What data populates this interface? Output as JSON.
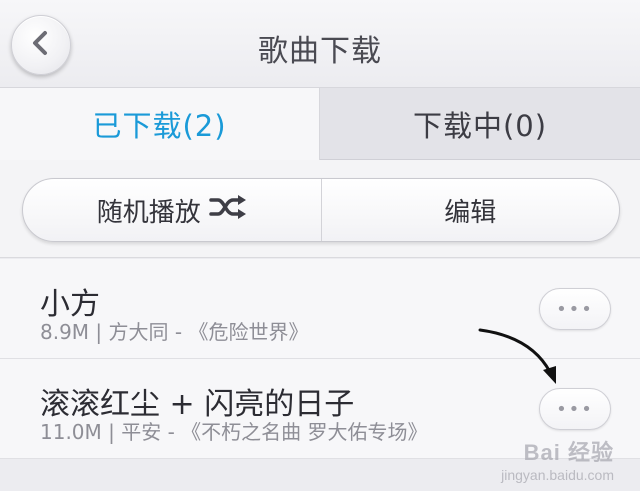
{
  "header": {
    "title": "歌曲下载",
    "back_icon": "chevron-left-icon"
  },
  "tabs": [
    {
      "label": "已下载(2)",
      "active": true
    },
    {
      "label": "下载中(0)",
      "active": false
    }
  ],
  "actions": {
    "shuffle_label": "随机播放",
    "shuffle_icon": "shuffle-icon",
    "edit_label": "编辑"
  },
  "songs": [
    {
      "title": "小方",
      "meta": "8.9M | 方大同 - 《危险世界》",
      "more_label": "•••"
    },
    {
      "title": "滚滚红尘 + 闪亮的日子",
      "meta": "11.0M | 平安 - 《不朽之名曲 罗大佑专场》",
      "more_label": "•••"
    }
  ],
  "watermark": {
    "brand": "Bai 经验",
    "url": "jingyan.baidu.com"
  },
  "colors": {
    "accent": "#1a9ad8",
    "background": "#ececf0",
    "text_primary": "#2c2c33",
    "text_secondary": "#8e8e96"
  }
}
